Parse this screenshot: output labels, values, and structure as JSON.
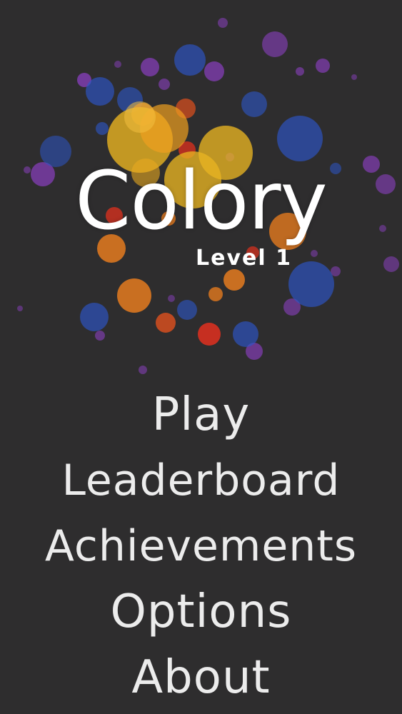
{
  "game": {
    "title": "Colory",
    "level": "Level 1"
  },
  "menu": {
    "items": [
      {
        "id": "play",
        "label": "Play"
      },
      {
        "id": "leaderboard",
        "label": "Leaderboard"
      },
      {
        "id": "achievements",
        "label": "Achievements"
      },
      {
        "id": "options",
        "label": "Options"
      },
      {
        "id": "about",
        "label": "About"
      }
    ]
  },
  "colors": {
    "background": "#2e2d2e",
    "text": "#ececec",
    "yellow": "#e8b321",
    "orange": "#f07f1e",
    "red": "#e0301e",
    "blue": "#2d56c9",
    "purple": "#8a3fc0"
  }
}
